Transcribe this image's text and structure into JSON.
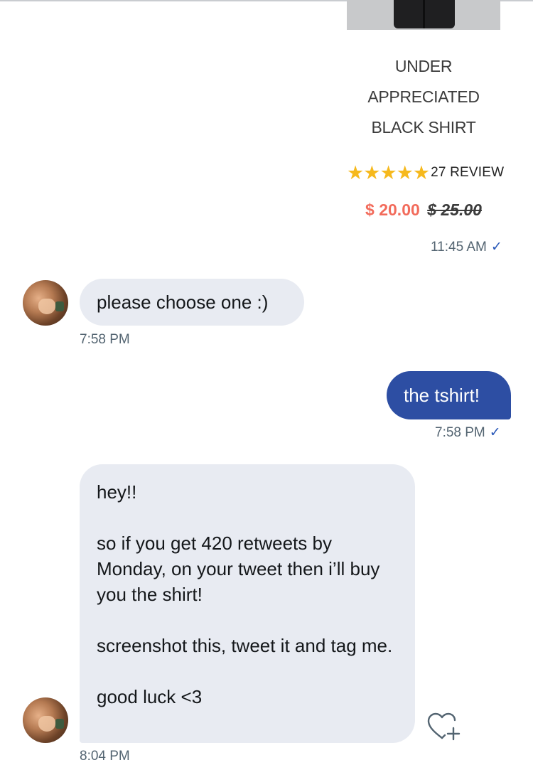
{
  "product": {
    "title_lines": [
      "UNDER",
      "APPRECIATED",
      "BLACK SHIRT"
    ],
    "rating_stars": 5,
    "reviews": "27 REVIEW",
    "price_sale": "$ 20.00",
    "price_original": "$ 25.00",
    "timestamp": "11:45 AM"
  },
  "messages": [
    {
      "id": "msg1",
      "direction": "incoming",
      "text": "please choose one :)",
      "timestamp": "7:58 PM"
    },
    {
      "id": "msg2",
      "direction": "outgoing",
      "text": "the tshirt!",
      "timestamp": "7:58 PM"
    },
    {
      "id": "msg3",
      "direction": "incoming",
      "text": "hey!!\n\nso if you get 420 retweets by Monday, on your tweet then i’ll buy you the shirt!\n\nscreenshot this, tweet it and tag me.\n\ngood luck <3",
      "timestamp": "8:04 PM"
    }
  ],
  "icons": {
    "read_receipt": "checkmark-icon",
    "react": "heart-plus-icon",
    "star": "star-icon"
  },
  "colors": {
    "outgoing_bubble": "#2d4ea3",
    "incoming_bubble": "#e8ebf2",
    "star": "#f6b91d",
    "sale_price": "#f26b5b"
  }
}
